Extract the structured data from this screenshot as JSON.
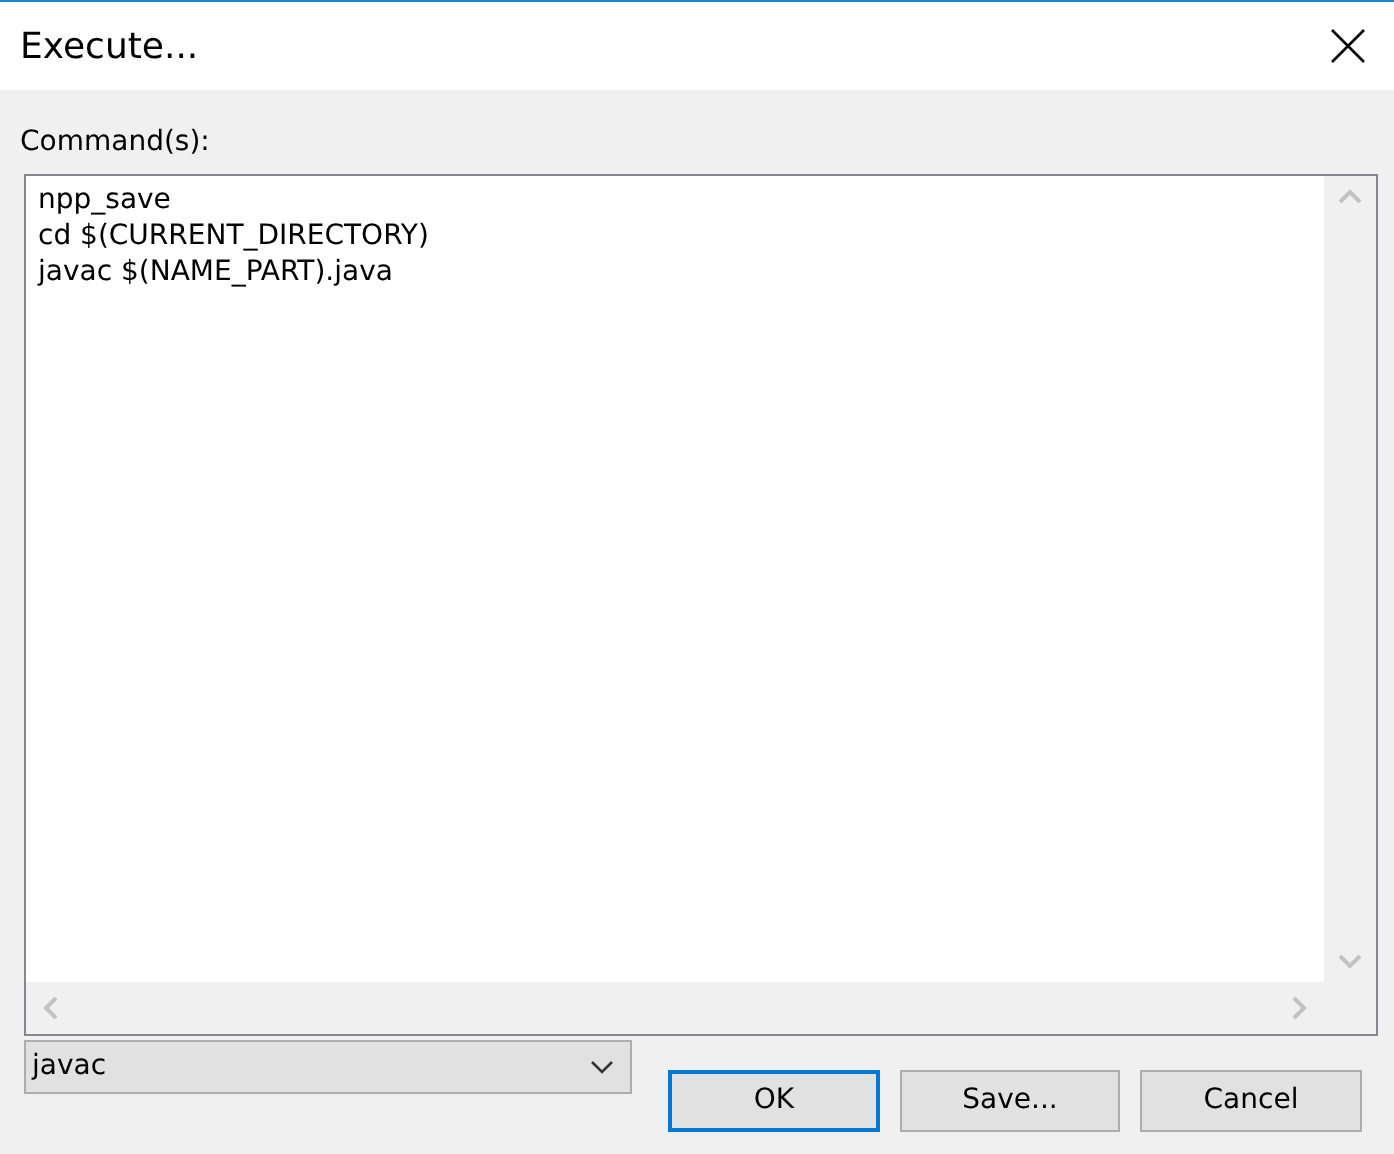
{
  "window": {
    "title": "Execute..."
  },
  "commands": {
    "label": "Command(s):",
    "lines": [
      "npp_save",
      "cd $(CURRENT_DIRECTORY)",
      "javac $(NAME_PART).java"
    ]
  },
  "script_select": {
    "value": "javac"
  },
  "buttons": [
    {
      "label": "OK",
      "default": true
    },
    {
      "label": "Save...",
      "default": false
    },
    {
      "label": "Cancel",
      "default": false
    }
  ]
}
